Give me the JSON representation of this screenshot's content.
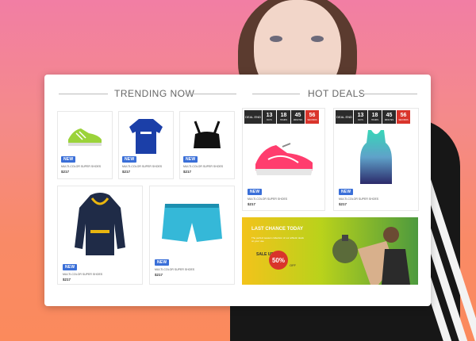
{
  "sections": {
    "trending_title": "TRENDING NOW",
    "deals_title": "HOT DEALS"
  },
  "products": [
    {
      "name": "MULTI-COLOR SUPER SHOES",
      "price": "$217",
      "badge": "NEW"
    },
    {
      "name": "MULTI-COLOR SUPER SHOES",
      "price": "$217",
      "badge": "NEW"
    },
    {
      "name": "MULTI-COLOR SUPER SHOES",
      "price": "$217",
      "badge": "NEW"
    },
    {
      "name": "MULTI-COLOR SUPER SHOES",
      "price": "$217",
      "badge": "NEW"
    },
    {
      "name": "MULTI-COLOR SUPER SHOES",
      "price": "$217",
      "badge": "NEW"
    }
  ],
  "deals": [
    {
      "name": "MULTI-COLOR SUPER SHOES",
      "price": "$217",
      "badge": "NEW",
      "countdown": {
        "label": "DEAL END",
        "days": "13",
        "hours": "18",
        "minutes": "45",
        "seconds": "56",
        "days_label": "DAYS",
        "hours_label": "HOURS",
        "minutes_label": "MINUTES",
        "seconds_label": "SECONDS"
      }
    },
    {
      "name": "MULTI-COLOR SUPER SHOES",
      "price": "$217",
      "badge": "NEW",
      "countdown": {
        "label": "DEAL END",
        "days": "13",
        "hours": "18",
        "minutes": "45",
        "seconds": "56",
        "days_label": "DAYS",
        "hours_label": "HOURS",
        "minutes_label": "MINUTES",
        "seconds_label": "SECONDS"
      }
    }
  ],
  "promo": {
    "title": "LAST CHANCE TODAY",
    "text": "The perfect season collection of our athletic deals on your use",
    "sale": "SALE UP TO",
    "percent": "50%",
    "off": "OFF"
  },
  "colors": {
    "accent": "#3a6fd8",
    "deal_red": "#d9342b"
  }
}
